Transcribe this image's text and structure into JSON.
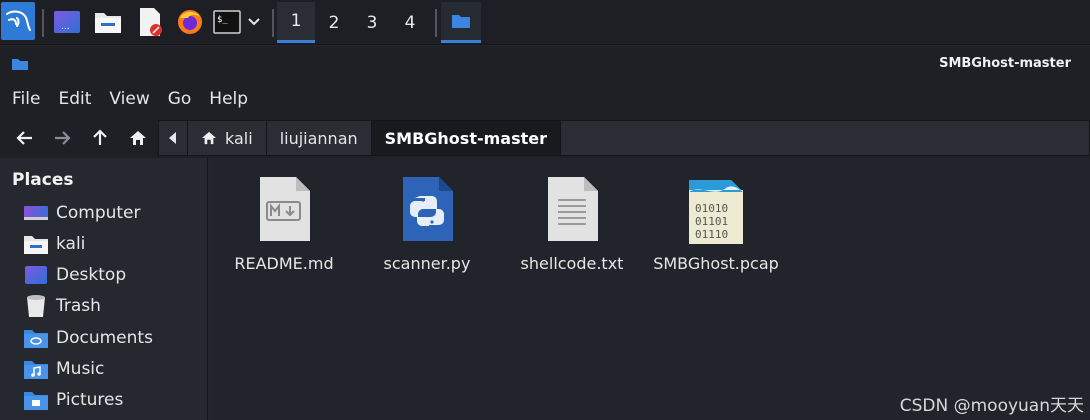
{
  "window": {
    "title": "SMBGhost-master"
  },
  "taskbar": {
    "workspaces": [
      "1",
      "2",
      "3",
      "4"
    ],
    "active_workspace": "1"
  },
  "menu": {
    "items": [
      "File",
      "Edit",
      "View",
      "Go",
      "Help"
    ]
  },
  "pathbar": {
    "crumbs": [
      "kali",
      "liujiannan",
      "SMBGhost-master"
    ]
  },
  "sidebar": {
    "heading": "Places",
    "items": [
      {
        "label": "Computer",
        "icon": "computer-icon"
      },
      {
        "label": "kali",
        "icon": "home-folder-icon"
      },
      {
        "label": "Desktop",
        "icon": "desktop-icon"
      },
      {
        "label": "Trash",
        "icon": "trash-icon"
      },
      {
        "label": "Documents",
        "icon": "documents-folder-icon"
      },
      {
        "label": "Music",
        "icon": "music-folder-icon"
      },
      {
        "label": "Pictures",
        "icon": "pictures-folder-icon"
      }
    ]
  },
  "files": [
    {
      "name": "README.md",
      "icon": "markdown-file-icon"
    },
    {
      "name": "scanner.py",
      "icon": "python-file-icon"
    },
    {
      "name": "shellcode.txt",
      "icon": "text-file-icon"
    },
    {
      "name": "SMBGhost.pcap",
      "icon": "binary-file-icon"
    }
  ],
  "pcap_icon_text": [
    "01010",
    "01101",
    "01110"
  ],
  "watermark": "CSDN @mooyuan天天",
  "colors": {
    "accent": "#3b80d8",
    "background": "#21242a",
    "sidebar": "#25282e"
  }
}
